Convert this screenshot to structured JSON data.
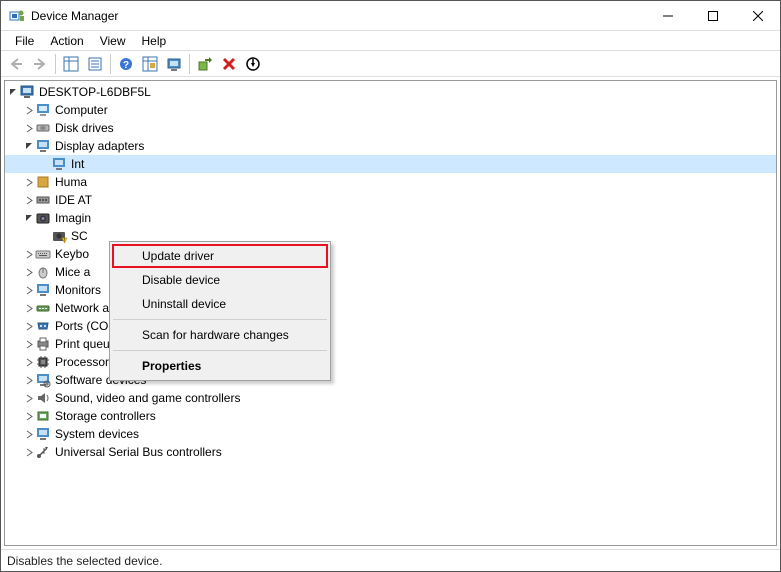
{
  "window": {
    "title": "Device Manager"
  },
  "menu": {
    "file": "File",
    "action": "Action",
    "view": "View",
    "help": "Help"
  },
  "tree": {
    "root": "DESKTOP-L6DBF5L",
    "computer": "Computer",
    "disk_drives": "Disk drives",
    "display_adapters": "Display adapters",
    "intel": "Int",
    "hid": "Huma",
    "ide": "IDE AT",
    "imaging": "Imagin",
    "sc": "SC",
    "keyboards": "Keybo",
    "mice": "Mice a",
    "monitors": "Monitors",
    "network": "Network adapters",
    "ports": "Ports (COM & LPT)",
    "print_queues": "Print queues",
    "processors": "Processors",
    "software": "Software devices",
    "sound": "Sound, video and game controllers",
    "storage": "Storage controllers",
    "system": "System devices",
    "usb": "Universal Serial Bus controllers"
  },
  "context_menu": {
    "update": "Update driver",
    "disable": "Disable device",
    "uninstall": "Uninstall device",
    "scan": "Scan for hardware changes",
    "properties": "Properties"
  },
  "status": "Disables the selected device."
}
